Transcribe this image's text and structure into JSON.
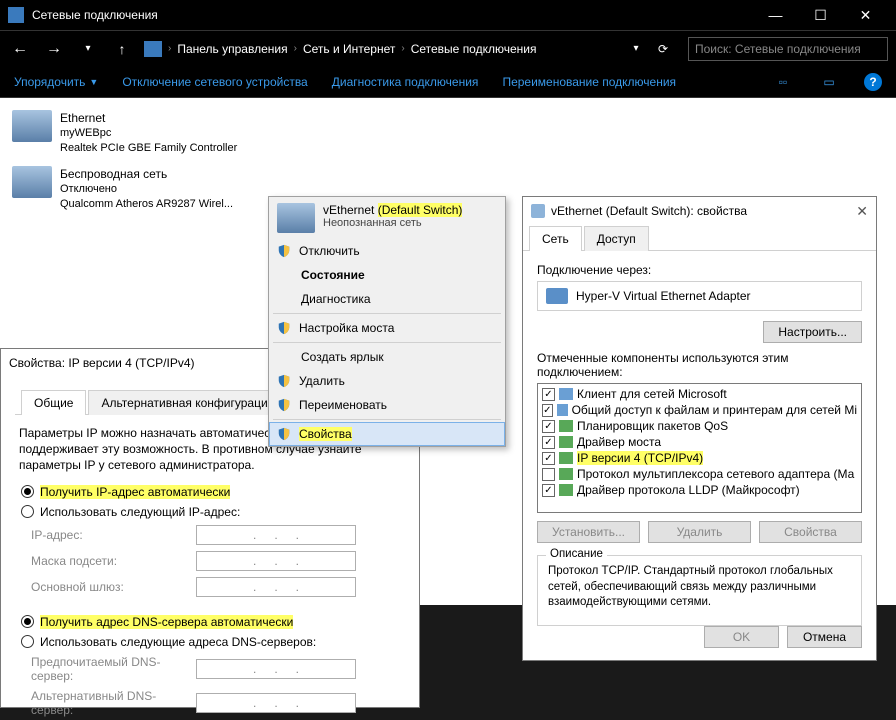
{
  "window": {
    "title": "Сетевые подключения"
  },
  "breadcrumb": {
    "items": [
      "Панель управления",
      "Сеть и Интернет",
      "Сетевые подключения"
    ]
  },
  "search": {
    "placeholder": "Поиск: Сетевые подключения"
  },
  "toolbar": {
    "organize": "Упорядочить",
    "disable": "Отключение сетевого устройства",
    "diagnose": "Диагностика подключения",
    "rename": "Переименование подключения"
  },
  "connections": [
    {
      "name": "Ethernet",
      "sub": "myWEBpc",
      "third": "Realtek PCIe GBE Family Controller"
    },
    {
      "name": "Беспроводная сеть",
      "sub": "Отключено",
      "third": "Qualcomm Atheros AR9287 Wirel..."
    },
    {
      "name": "vEthernet ",
      "name2": "(Default Switch)",
      "sub": "Неопознанная сеть",
      "third": "Hyper-V Virtual Ethernet Adapter"
    }
  ],
  "ctx": {
    "items": [
      "Отключить",
      "Состояние",
      "Диагностика",
      "Настройка моста",
      "Создать ярлык",
      "Удалить",
      "Переименовать",
      "Свойства"
    ]
  },
  "props": {
    "title": "vEthernet (Default Switch): свойства",
    "tab_net": "Сеть",
    "tab_access": "Доступ",
    "connect_via": "Подключение через:",
    "adapter": "Hyper-V Virtual Ethernet Adapter",
    "configure": "Настроить...",
    "checked_text": "Отмеченные компоненты используются этим подключением:",
    "components": [
      "Клиент для сетей Microsoft",
      "Общий доступ к файлам и принтерам для сетей Mi",
      "Планировщик пакетов QoS",
      "Драйвер моста",
      "IP версии 4 (TCP/IPv4)",
      "Протокол мультиплексора сетевого адаптера (Ма",
      "Драйвер протокола LLDP (Майкрософт)"
    ],
    "comp_checked": [
      true,
      true,
      true,
      true,
      true,
      false,
      true
    ],
    "install": "Установить...",
    "remove": "Удалить",
    "properties": "Свойства",
    "desc_label": "Описание",
    "desc": "Протокол TCP/IP. Стандартный протокол глобальных сетей, обеспечивающий связь между различными взаимодействующими сетями.",
    "ok": "OK",
    "cancel": "Отмена"
  },
  "ipv4": {
    "title": "Свойства: IP версии 4 (TCP/IPv4)",
    "tab_general": "Общие",
    "tab_alt": "Альтернативная конфигурация",
    "explain": "Параметры IP можно назначать автоматически, если сеть поддерживает эту возможность. В противном случае узнайте параметры IP у сетевого администратора.",
    "auto_ip": "Получить IP-адрес автоматически",
    "manual_ip": "Использовать следующий IP-адрес:",
    "ip_addr": "IP-адрес:",
    "mask": "Маска подсети:",
    "gateway": "Основной шлюз:",
    "auto_dns": "Получить адрес DNS-сервера автоматически",
    "manual_dns": "Использовать следующие адреса DNS-серверов:",
    "pref_dns": "Предпочитаемый DNS-сервер:",
    "alt_dns": "Альтернативный DNS-сервер:"
  }
}
